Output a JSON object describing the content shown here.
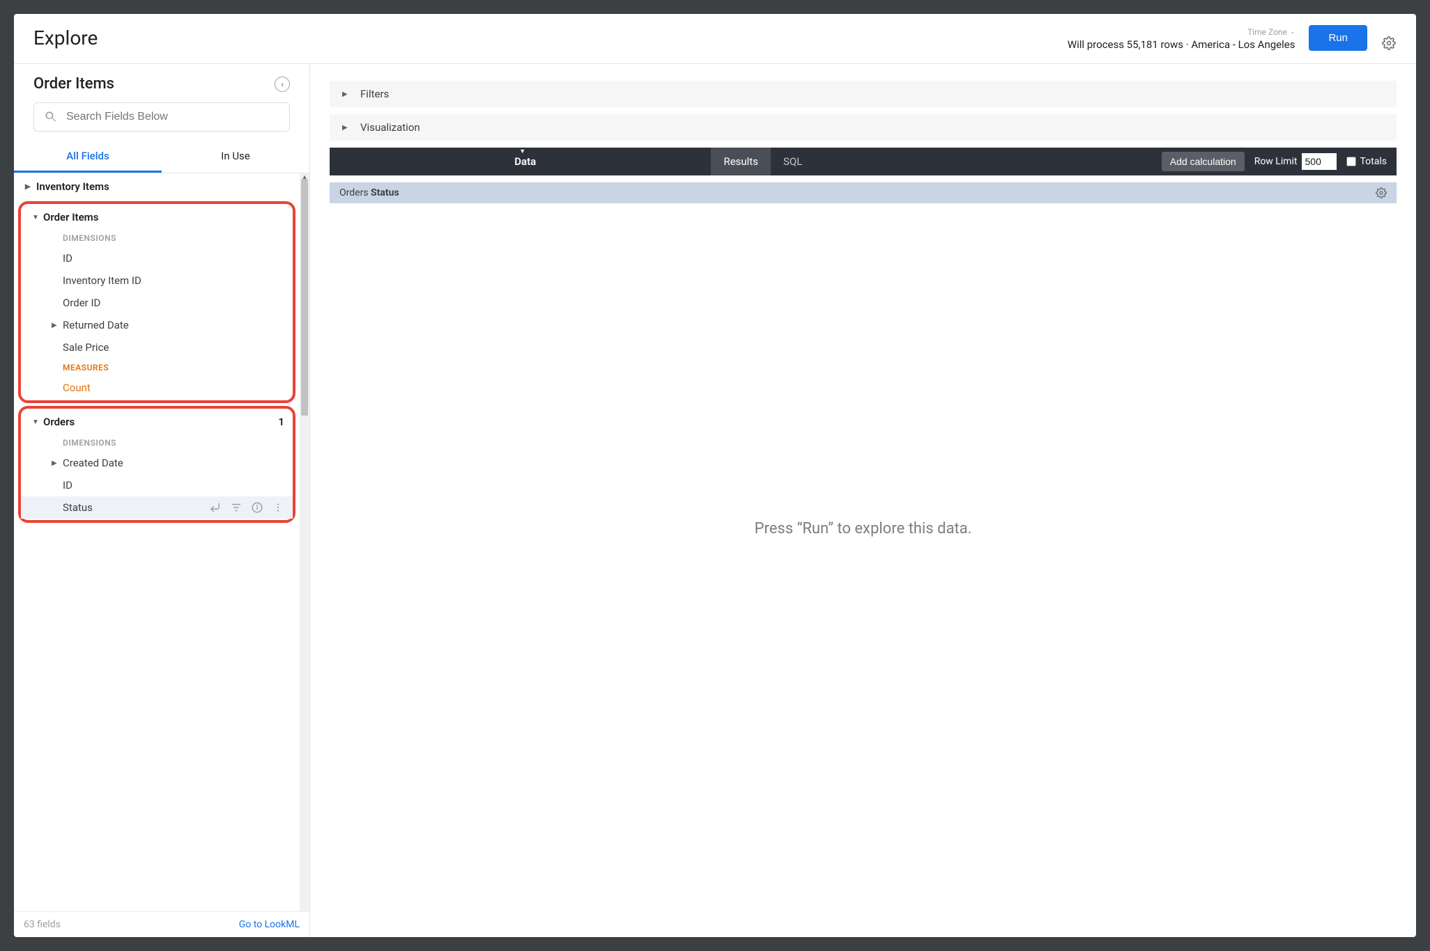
{
  "header": {
    "title": "Explore",
    "timezone_label": "Time Zone",
    "meta_line": "Will process 55,181 rows · America - Los Angeles",
    "run_label": "Run"
  },
  "sidebar": {
    "title": "Order Items",
    "search_placeholder": "Search Fields Below",
    "tabs": {
      "all": "All Fields",
      "in_use": "In Use"
    },
    "footer_count": "63 fields",
    "footer_link": "Go to LookML"
  },
  "tree": {
    "view_inventory_items": "Inventory Items",
    "view_order_items": "Order Items",
    "view_orders": "Orders",
    "orders_badge": "1",
    "labels": {
      "dimensions": "DIMENSIONS",
      "measures": "MEASURES"
    },
    "order_items": {
      "id": "ID",
      "inventory_item_id": "Inventory Item ID",
      "order_id": "Order ID",
      "returned_date": "Returned Date",
      "sale_price": "Sale Price",
      "count": "Count"
    },
    "orders": {
      "created_date": "Created Date",
      "id": "ID",
      "status": "Status"
    }
  },
  "main": {
    "filters": "Filters",
    "visualization": "Visualization",
    "data_tab": "Data",
    "results_tab": "Results",
    "sql_tab": "SQL",
    "add_calc": "Add calculation",
    "row_limit_label": "Row Limit",
    "row_limit_value": "500",
    "totals_label": "Totals",
    "col_header_prefix": "Orders",
    "col_header_field": "Status",
    "empty_prompt": "Press “Run” to explore this data."
  }
}
